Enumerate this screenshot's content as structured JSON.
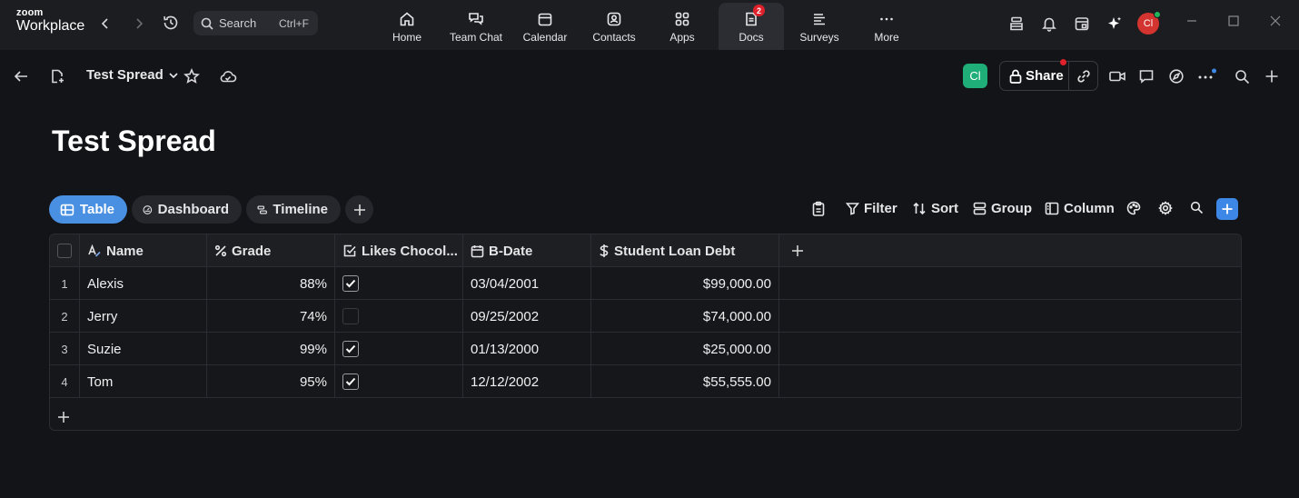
{
  "app": {
    "logo_line1": "zoom",
    "logo_line2": "Workplace",
    "search_placeholder": "Search",
    "search_shortcut": "Ctrl+F",
    "nav": [
      {
        "label": "Home",
        "icon": "home-icon"
      },
      {
        "label": "Team Chat",
        "icon": "chat-icon"
      },
      {
        "label": "Calendar",
        "icon": "calendar-icon"
      },
      {
        "label": "Contacts",
        "icon": "contacts-icon"
      },
      {
        "label": "Apps",
        "icon": "apps-icon"
      },
      {
        "label": "Docs",
        "icon": "docs-icon",
        "badge": "2",
        "active": true
      },
      {
        "label": "Surveys",
        "icon": "surveys-icon"
      },
      {
        "label": "More",
        "icon": "more-icon"
      }
    ],
    "user_initials": "Cl"
  },
  "doc": {
    "title": "Test Spread",
    "collaborator_initials": "Cl",
    "share_label": "Share"
  },
  "views": {
    "tabs": [
      "Table",
      "Dashboard",
      "Timeline"
    ],
    "active": "Table",
    "tools": [
      "Filter",
      "Sort",
      "Group",
      "Column"
    ]
  },
  "table": {
    "columns": [
      {
        "label": "Name",
        "icon": "text-field-icon"
      },
      {
        "label": "Grade",
        "icon": "percent-icon"
      },
      {
        "label": "Likes Chocol...",
        "icon": "checkbox-field-icon"
      },
      {
        "label": "B-Date",
        "icon": "date-field-icon"
      },
      {
        "label": "Student Loan Debt",
        "icon": "currency-icon"
      }
    ],
    "rows": [
      {
        "n": "1",
        "name": "Alexis",
        "grade": "88%",
        "likes": true,
        "bdate": "03/04/2001",
        "debt": "$99,000.00"
      },
      {
        "n": "2",
        "name": "Jerry",
        "grade": "74%",
        "likes": false,
        "bdate": "09/25/2002",
        "debt": "$74,000.00"
      },
      {
        "n": "3",
        "name": "Suzie",
        "grade": "99%",
        "likes": true,
        "bdate": "01/13/2000",
        "debt": "$25,000.00"
      },
      {
        "n": "4",
        "name": "Tom",
        "grade": "95%",
        "likes": true,
        "bdate": "12/12/2002",
        "debt": "$55,555.00"
      }
    ]
  },
  "colors": {
    "accent": "#4a90e2",
    "background": "#131417",
    "topbar": "#1c1d21",
    "notification": "#e0202a",
    "online": "#22b35a",
    "collaborator": "#1fad78"
  }
}
